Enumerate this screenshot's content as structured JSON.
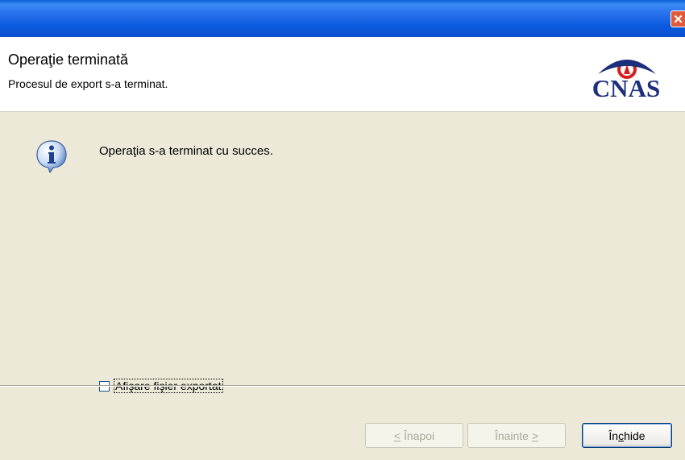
{
  "window": {
    "close_glyph": "✕"
  },
  "header": {
    "title": "Operaţie terminată",
    "subtitle": "Procesul de export s-a terminat.",
    "logo_text": "CNAS"
  },
  "content": {
    "icon": "info-icon",
    "message": "Operaţia s-a terminat cu succes."
  },
  "checkbox": {
    "label": "Afişare fişier exportat",
    "checked": false
  },
  "buttons": {
    "back_ul": "<",
    "back_rest": " Înapoi",
    "next_rest": "Înainte ",
    "next_ul": ">",
    "close_pre": "În",
    "close_ul": "c",
    "close_post": "hide"
  },
  "colors": {
    "titlebar": "#0b5ade",
    "logo_blue": "#1c2f7a",
    "logo_red": "#d42020",
    "close_red": "#e25a3a"
  }
}
